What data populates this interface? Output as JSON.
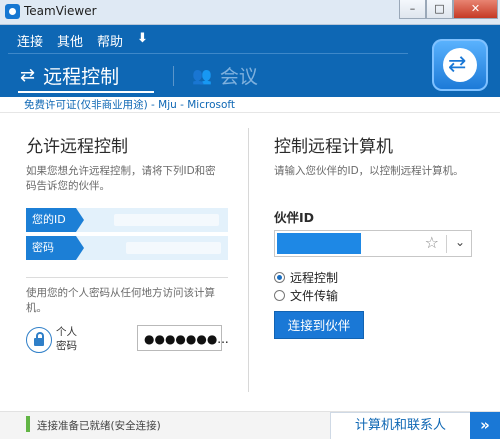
{
  "window": {
    "title": "TeamViewer",
    "minimize": "–",
    "maximize": "□",
    "close": "✕"
  },
  "menu": {
    "items": [
      "连接",
      "其他",
      "帮助"
    ],
    "download": "⬇"
  },
  "tabs": {
    "remote": "远程控制",
    "meeting": "会议",
    "remote_icon": "⇄",
    "meeting_icon": "👥"
  },
  "license": "免费许可证(仅非商业用途) - Mju - Microsoft",
  "left": {
    "title": "允许远程控制",
    "desc": "如果您想允许远程控制，请将下列ID和密码告诉您的伙伴。",
    "id_label": "您的ID",
    "pw_label": "密码",
    "personal_desc": "使用您的个人密码从任何地方访问该计算机。",
    "personal_label": "个人密码",
    "personal_value": "●●●●●●●..."
  },
  "right": {
    "title": "控制远程计算机",
    "desc": "请输入您伙伴的ID，以控制远程计算机。",
    "partner_label": "伙伴ID",
    "radio_remote": "远程控制",
    "radio_transfer": "文件传输",
    "connect": "连接到伙伴",
    "star": "☆",
    "chevron": "⌄"
  },
  "status": {
    "text": "连接准备已就绪(安全连接)",
    "contacts": "计算机和联系人",
    "contacts_arrow": "»"
  },
  "colors": {
    "brand": "#0e67b4",
    "button": "#1a78d6",
    "status_ok": "#62b545"
  }
}
